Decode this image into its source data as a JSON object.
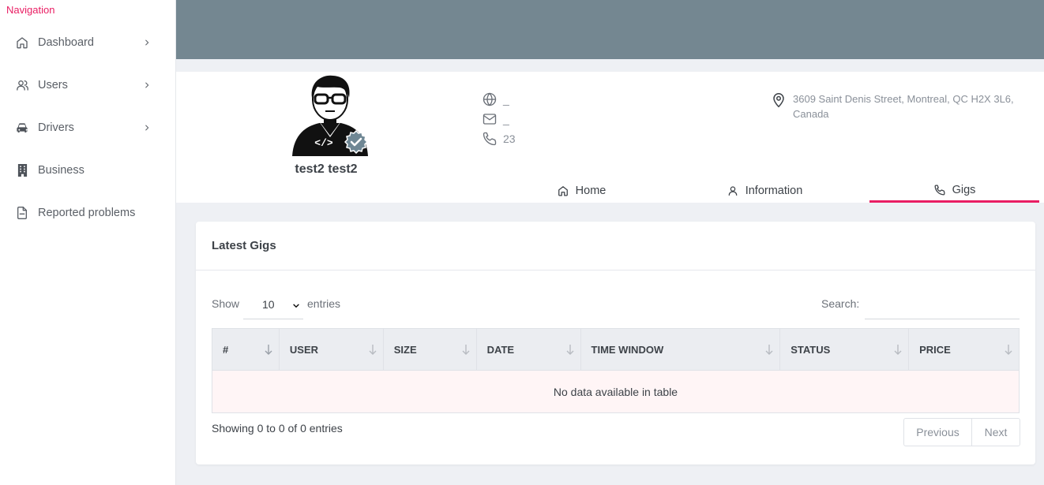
{
  "sidebar": {
    "title": "Navigation",
    "items": [
      {
        "label": "Dashboard"
      },
      {
        "label": "Users"
      },
      {
        "label": "Drivers"
      },
      {
        "label": "Business"
      },
      {
        "label": "Reported problems"
      }
    ]
  },
  "profile": {
    "name": "test2 test2",
    "website": "_",
    "email": "_",
    "phone": "23",
    "address": "3609 Saint Denis Street, Montreal, QC H2X 3L6, Canada",
    "tabs": [
      {
        "label": "Home"
      },
      {
        "label": "Information"
      },
      {
        "label": "Gigs"
      }
    ]
  },
  "gigs": {
    "title": "Latest Gigs",
    "show_label": "Show",
    "entries_value": "10",
    "entries_label": "entries",
    "search_label": "Search:",
    "search_value": "",
    "columns": [
      "#",
      "USER",
      "SIZE",
      "DATE",
      "TIME WINDOW",
      "STATUS",
      "PRICE"
    ],
    "empty_message": "No data available in table",
    "info": "Showing 0 to 0 of 0 entries",
    "prev_label": "Previous",
    "next_label": "Next"
  },
  "colors": {
    "accent": "#e91e63",
    "banner": "#748791",
    "verified_badge": "#6f8794"
  },
  "icons": {
    "sidebar": [
      "home-icon",
      "users-icon",
      "car-icon",
      "building-icon",
      "file-icon"
    ],
    "chevron": "chevron-right-icon",
    "contact": [
      "globe-icon",
      "mail-icon",
      "phone-icon"
    ],
    "address": "map-pin-icon",
    "tabs": [
      "home-icon",
      "user-icon",
      "phone-icon"
    ]
  }
}
